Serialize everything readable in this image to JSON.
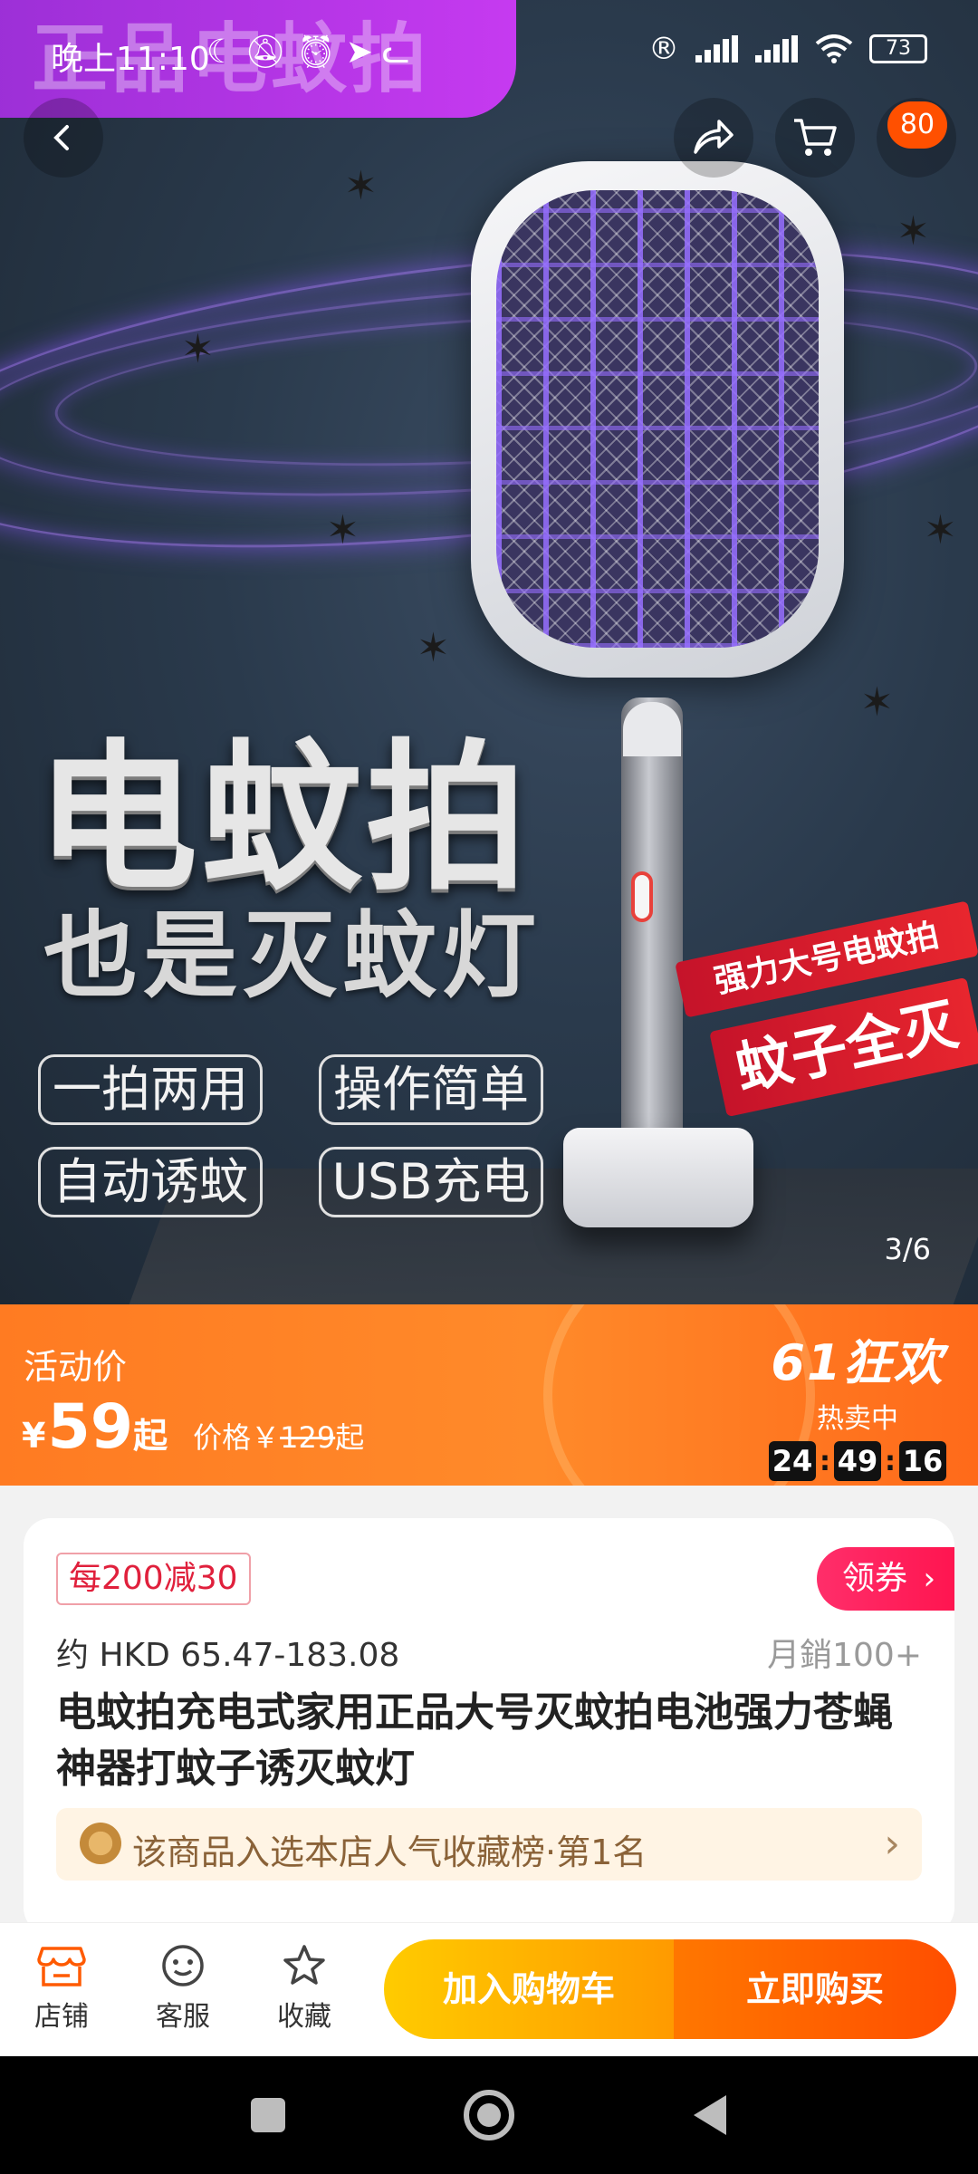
{
  "status_bar": {
    "time": "晚上11:10",
    "battery": "73"
  },
  "hero": {
    "badge_text": "正品电蚊拍",
    "title": "电蚊拍",
    "subtitle": "也是灭蚊灯",
    "features": [
      "一拍两用",
      "操作简单",
      "自动诱蚊",
      "USB充电"
    ],
    "banner_top": "强力大号电蚊拍",
    "banner_bottom": "蚊子全灭",
    "counter": "3/6"
  },
  "cart_badge": "80",
  "promo": {
    "label": "活动价",
    "currency": "¥",
    "price": "59",
    "qi": "起",
    "orig_prefix": "价格￥",
    "orig_value": "129",
    "orig_suffix": "起",
    "festival": "61狂欢",
    "hot": "热卖中",
    "countdown": [
      "24",
      "49",
      "16"
    ]
  },
  "card": {
    "coupon_tag": "每200减30",
    "get_coupon": "领券",
    "price_range": "约 HKD 65.47-183.08",
    "sales": "月銷100+",
    "title": "电蚊拍充电式家用正品大号灭蚊拍电池强力苍蝇神器打蚊子诱灭蚊灯",
    "rank": "该商品入选本店人气收藏榜·第1名"
  },
  "action_bar": {
    "shop": "店铺",
    "service": "客服",
    "favorite": "收藏",
    "add_cart": "加入购物车",
    "buy_now": "立即购买"
  }
}
